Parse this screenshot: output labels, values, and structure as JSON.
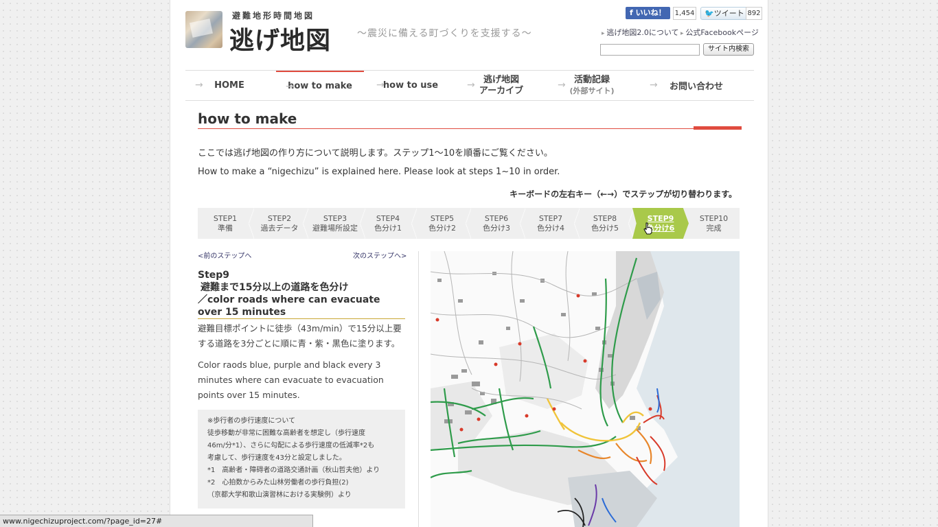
{
  "header": {
    "logo_sub": "避難地形時間地図",
    "logo_main": "逃げ地図",
    "tagline": "〜震災に備える町づくりを支援する〜",
    "fb_like": "いいね！",
    "fb_count": "1,454",
    "tweet": "ツイート",
    "tweet_count": "892",
    "link_about": "逃げ地図2.0について",
    "link_facebook": "公式Facebookページ",
    "search_value": "",
    "search_button": "サイト内検索"
  },
  "nav": {
    "items": [
      {
        "label": "HOME"
      },
      {
        "label": "how to make"
      },
      {
        "label": "how to use"
      },
      {
        "line1": "逃げ地図",
        "line2": "アーカイブ"
      },
      {
        "line1": "活動記録",
        "line2": "(外部サイト)"
      },
      {
        "label": "お問い合わせ"
      }
    ]
  },
  "main": {
    "title": "how to make",
    "intro_ja": "ここでは逃げ地図の作り方について説明します。ステップ1〜10を順番にご覧ください。",
    "intro_en": "How to make a “nigechizu” is explained here. Please look at steps 1~10 in order.",
    "kbd_note": "キーボードの左右キー（←→）でステップが切り替わります。"
  },
  "steps": [
    {
      "num": "STEP1",
      "name": "準備"
    },
    {
      "num": "STEP2",
      "name": "過去データ"
    },
    {
      "num": "STEP3",
      "name": "避難場所設定"
    },
    {
      "num": "STEP4",
      "name": "色分け1"
    },
    {
      "num": "STEP5",
      "name": "色分け2"
    },
    {
      "num": "STEP6",
      "name": "色分け3"
    },
    {
      "num": "STEP7",
      "name": "色分け4"
    },
    {
      "num": "STEP8",
      "name": "色分け5"
    },
    {
      "num": "STEP9",
      "name": "色分け6"
    },
    {
      "num": "STEP10",
      "name": "完成"
    }
  ],
  "content": {
    "prev": "<前のステップへ",
    "next": "次のステップへ>",
    "step_label": "Step9",
    "step_title_ja": "避難まで15分以上の道路を色分け",
    "step_title_en": "／color roads where can evacuate over 15 minutes",
    "desc_ja": "避難目標ポイントに徒歩（43m/min）で15分以上要する道路を3分ごとに順に青・紫・黒色に塗ります。",
    "desc_en": "Color raods blue, purple and black every 3 minutes where can evacuate to evacuation points over 15 minutes.",
    "note_lines": [
      "※歩行者の歩行速度について",
      "徒歩移動が非常に困難な高齢者を想定し（歩行速度",
      "46m/分*1）、さらに勾配による歩行速度の低減率*2も",
      "考慮して、歩行速度を43分と設定しました。",
      "*1　高齢者・障碍者の道路交通計画（秋山哲夫他）より",
      "*2　心拍数からみた山林労働者の歩行負担(2)",
      "（京都大学和歌山演習林における実験例）より"
    ]
  },
  "statusbar": "www.nigechizuproject.com/?page_id=27#",
  "colors": {
    "accent": "#e04b3f",
    "active_step": "#a9c94a",
    "road_green": "#2e9b4a",
    "road_yellow": "#f0c43a",
    "road_orange": "#e8862a",
    "road_red": "#d83a2a",
    "road_blue": "#2b6bd6",
    "road_purple": "#6a3aa8"
  }
}
